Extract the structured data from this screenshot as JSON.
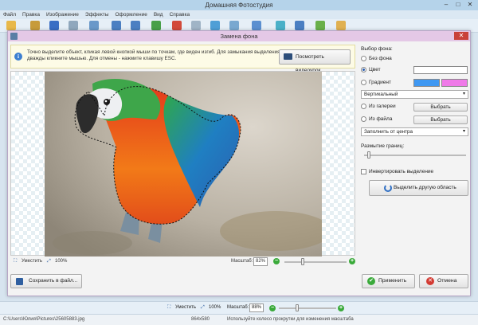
{
  "app": {
    "title": "Домашняя Фотостудия",
    "menu": [
      "Файл",
      "Правка",
      "Изображение",
      "Эффекты",
      "Оформление",
      "Вид",
      "Справка"
    ]
  },
  "dialog": {
    "title": "Замена фона",
    "hint": "Точно выделите объект, кликая левой кнопкой мыши по точкам, где виден изгиб. Для замыкания выделения дважды кликните мышью. Для отмены - нажмите клавишу ESC.",
    "video_button": "Посмотреть видеоурок",
    "footer": {
      "fit_label": "Уместить",
      "percent_label": "100%",
      "scale_label": "Масштаб:",
      "scale_value": "82%",
      "scale_level_percent": 30
    },
    "save_button": "Сохранить в файл...",
    "apply_button": "Применить",
    "cancel_button": "Отмена",
    "options": {
      "section_title": "Выбор фона:",
      "no_background": "Без фона",
      "color": "Цвет",
      "gradient": "Градиент",
      "gradient_direction": "Вертикальный",
      "from_gallery": "Из галереи",
      "from_file": "Из файла",
      "choose_button": "Выбрать",
      "fill_mode": "Заполнить от центра",
      "blur_label": "Размытие границ:",
      "invert_label": "Инвертировать выделение",
      "select_other_button": "Выделить другую область",
      "blur_level_percent": 5,
      "color_value": "#ffffff",
      "gradient_color_1": "#3f98f2",
      "gradient_color_2": "#ef7ae8"
    }
  },
  "bottom": {
    "fit_label": "Уместить",
    "percent_label": "100%",
    "scale_label": "Масштаб:",
    "scale_value": "88%",
    "scale_level_percent": 32
  },
  "status": {
    "path": "C:\\Users\\Юлия\\Pictures\\25605883.jpg",
    "dimensions": "864x580",
    "hint": "Используйте колесо прокрутки для изменения масштаба"
  }
}
